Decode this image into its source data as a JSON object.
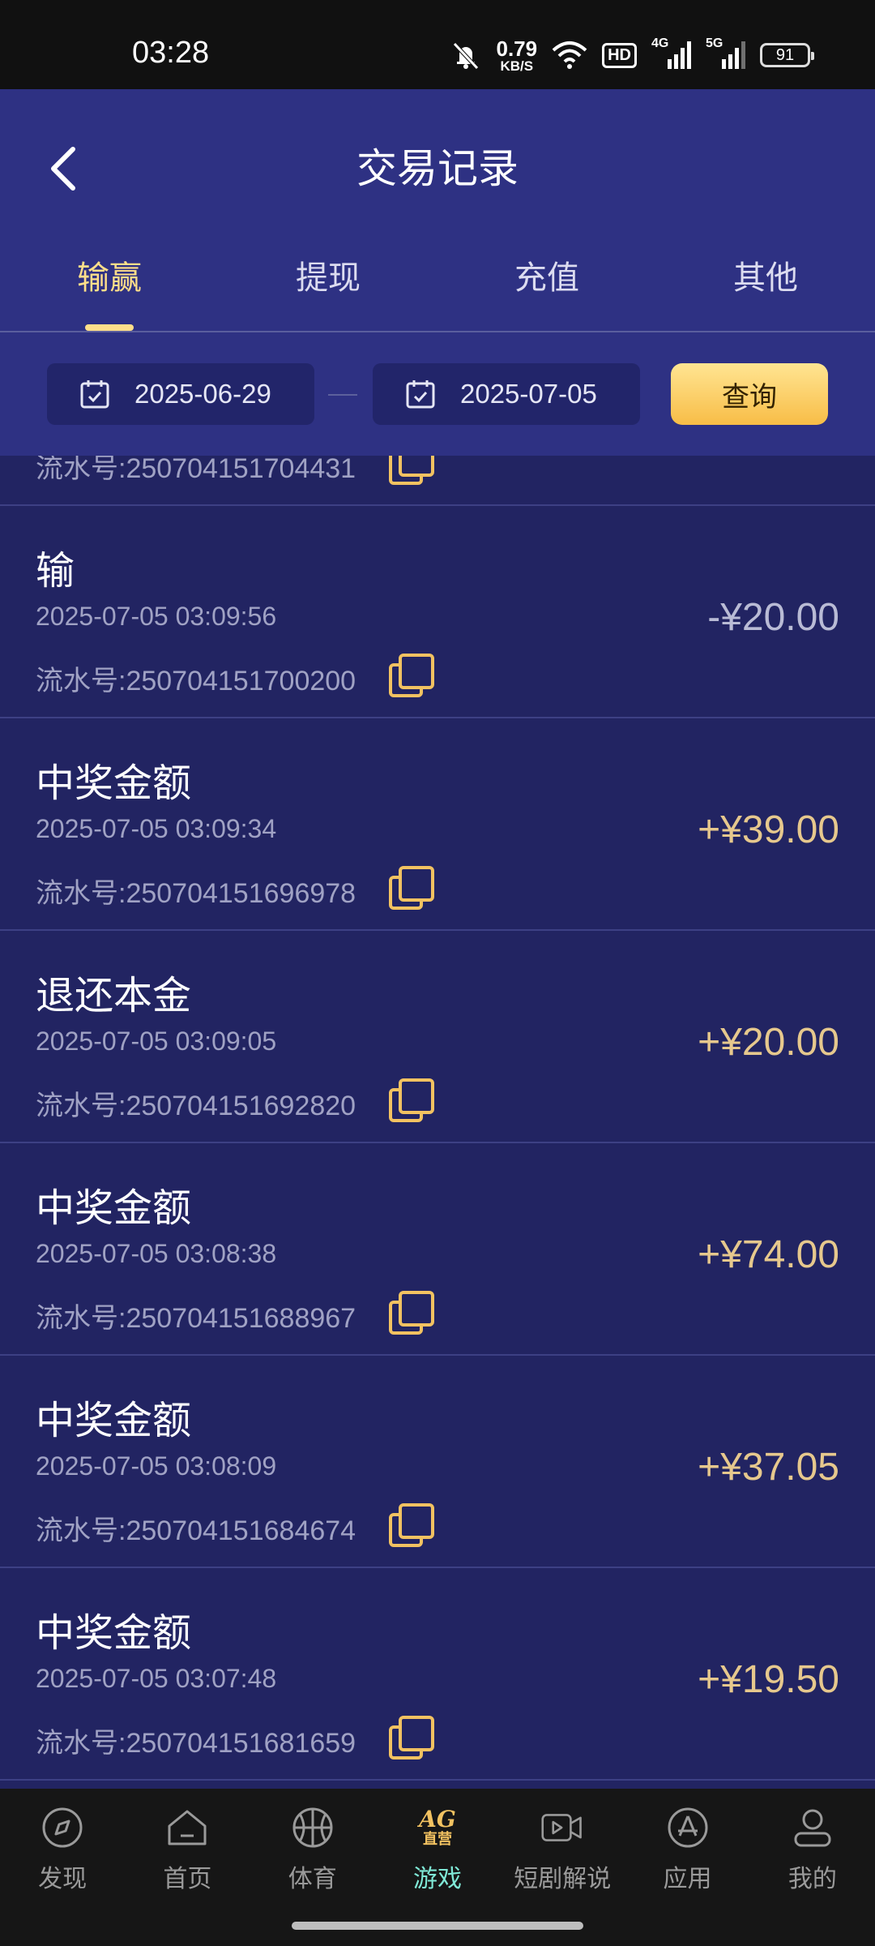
{
  "status_bar": {
    "time": "03:28",
    "speed_value": "0.79",
    "speed_unit": "KB/S",
    "hd": "HD",
    "sig1": "4G",
    "sig2": "5G",
    "battery": "91"
  },
  "header": {
    "title": "交易记录"
  },
  "tabs": [
    {
      "label": "输赢",
      "active": true
    },
    {
      "label": "提现",
      "active": false
    },
    {
      "label": "充值",
      "active": false
    },
    {
      "label": "其他",
      "active": false
    }
  ],
  "filter": {
    "start_date": "2025-06-29",
    "end_date": "2025-07-05",
    "query_label": "查询"
  },
  "partial_item": {
    "serial": "流水号:250704151704431"
  },
  "records": [
    {
      "type": "输",
      "time": "2025-07-05 03:09:56",
      "serial": "流水号:250704151700200",
      "amount": "-¥20.00"
    },
    {
      "type": "中奖金额",
      "time": "2025-07-05 03:09:34",
      "serial": "流水号:250704151696978",
      "amount": "+¥39.00"
    },
    {
      "type": "退还本金",
      "time": "2025-07-05 03:09:05",
      "serial": "流水号:250704151692820",
      "amount": "+¥20.00"
    },
    {
      "type": "中奖金额",
      "time": "2025-07-05 03:08:38",
      "serial": "流水号:250704151688967",
      "amount": "+¥74.00"
    },
    {
      "type": "中奖金额",
      "time": "2025-07-05 03:08:09",
      "serial": "流水号:250704151684674",
      "amount": "+¥37.05"
    },
    {
      "type": "中奖金额",
      "time": "2025-07-05 03:07:48",
      "serial": "流水号:250704151681659",
      "amount": "+¥19.50"
    }
  ],
  "bottom_nav": [
    {
      "label": "发现",
      "icon": "compass-icon"
    },
    {
      "label": "首页",
      "icon": "home-icon"
    },
    {
      "label": "体育",
      "icon": "basketball-icon"
    },
    {
      "label": "游戏",
      "icon": "ag-logo",
      "logo_text": "AG",
      "logo_sub": "直营",
      "active": true
    },
    {
      "label": "短剧解说",
      "icon": "video-icon"
    },
    {
      "label": "应用",
      "icon": "app-store-icon"
    },
    {
      "label": "我的",
      "icon": "profile-icon"
    }
  ],
  "colors": {
    "header_bg": "#2e3183",
    "list_bg": "#222462",
    "accent_gold": "#ffdf8a",
    "amount_positive": "#e6c88d",
    "nav_active": "#7fe8d6"
  }
}
